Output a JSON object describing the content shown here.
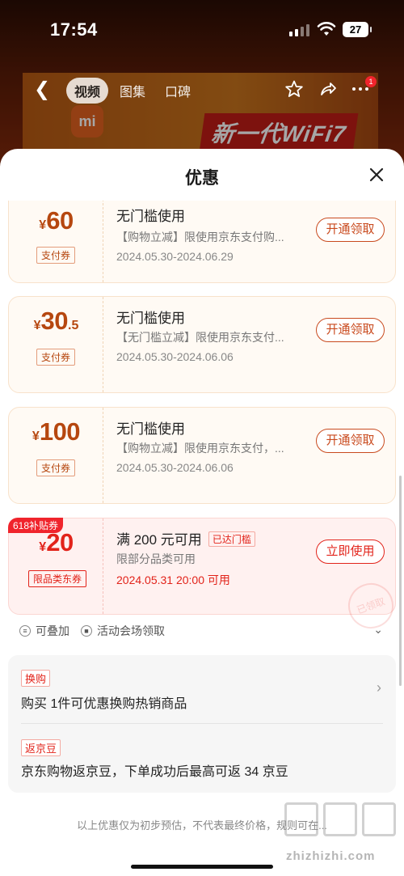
{
  "status_bar": {
    "time": "17:54",
    "battery": "27"
  },
  "background": {
    "tabs": [
      {
        "label": "视频",
        "active": true
      },
      {
        "label": "图集",
        "active": false
      },
      {
        "label": "口碑",
        "active": false
      }
    ],
    "logo_text": "mi",
    "promo_text": "新一代WiFi7",
    "notification_count": "1"
  },
  "sheet": {
    "title": "优惠"
  },
  "coupons": [
    {
      "currency": "¥",
      "amount": "60",
      "decimal": "",
      "type": "支付券",
      "title": "无门槛使用",
      "desc": "【购物立减】限使用京东支付购...",
      "date": "2024.05.30-2024.06.29",
      "button": "开通领取"
    },
    {
      "currency": "¥",
      "amount": "30",
      "decimal": ".5",
      "type": "支付券",
      "title": "无门槛使用",
      "desc": "【无门槛立减】限使用京东支付...",
      "date": "2024.05.30-2024.06.06",
      "button": "开通领取"
    },
    {
      "currency": "¥",
      "amount": "100",
      "decimal": "",
      "type": "支付券",
      "title": "无门槛使用",
      "desc": "【购物立减】限使用京东支付，...",
      "date": "2024.05.30-2024.06.06",
      "button": "开通领取"
    },
    {
      "tag": "618补贴券",
      "currency": "¥",
      "amount": "20",
      "decimal": "",
      "type": "限品类东券",
      "title": "满 200 元可用",
      "reached": "已达门槛",
      "desc": "限部分品类可用",
      "date": "2024.05.31 20:00 可用",
      "button": "立即使用",
      "stamp": "已领取"
    }
  ],
  "meta": {
    "stackable": "可叠加",
    "venue": "活动会场领取"
  },
  "offers": [
    {
      "tag": "换购",
      "text": "购买 1件可优惠换购热销商品"
    },
    {
      "tag": "返京豆",
      "text": "京东购物返京豆，下单成功后最高可返 34 京豆"
    }
  ],
  "footer_note": "以上优惠仅为初步预估，不代表最终价格，规则可在...",
  "watermark": "zhizhizhi.com",
  "colors": {
    "accent": "#e2231a",
    "coupon_orange": "#b6470f",
    "coupon_bg": "#fffaf4"
  }
}
